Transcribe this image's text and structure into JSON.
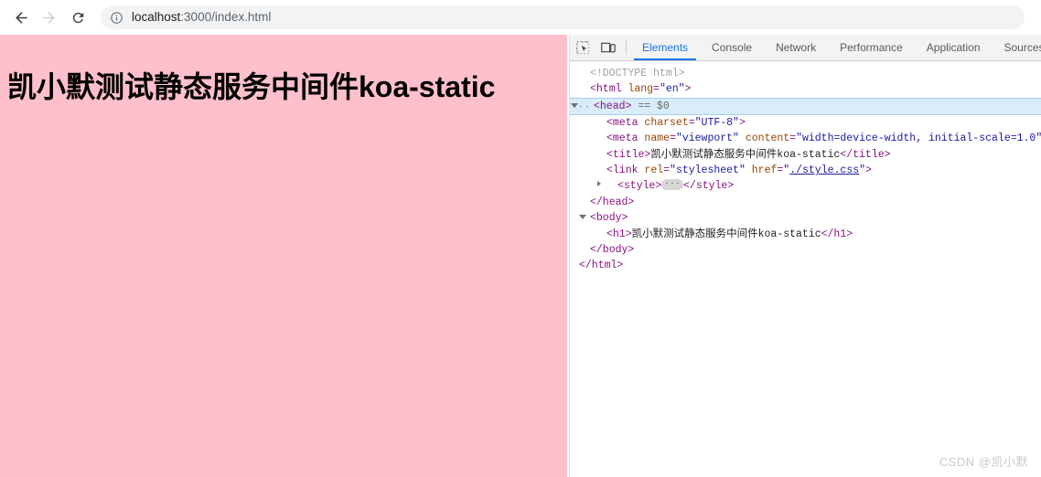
{
  "browser": {
    "back_label": "Back",
    "forward_label": "Forward",
    "reload_label": "Reload",
    "url_host": "localhost",
    "url_path": ":3000/index.html",
    "url_full": "localhost:3000/index.html",
    "info_icon": "info-circle-icon"
  },
  "page": {
    "heading": "凯小默测试静态服务中间件koa-static",
    "background_color": "#ffc0cb"
  },
  "devtools": {
    "inspect_icon": "inspect-element-icon",
    "device_icon": "device-toolbar-icon",
    "accent_color": "#1a73e8",
    "tabs": [
      {
        "label": "Elements",
        "active": true
      },
      {
        "label": "Console",
        "active": false
      },
      {
        "label": "Network",
        "active": false
      },
      {
        "label": "Performance",
        "active": false
      },
      {
        "label": "Application",
        "active": false
      },
      {
        "label": "Sources",
        "active": false
      }
    ],
    "dom": {
      "doctype": "<!DOCTYPE html>",
      "html_open_tag": "<html",
      "html_attr_name": "lang",
      "html_attr_value": "\"en\"",
      "html_close_bracket": ">",
      "head_open": "<head>",
      "head_marker": "== $0",
      "head_dots": "···",
      "meta_charset": {
        "open": "<meta",
        "attr_name": "charset",
        "attr_value": "\"UTF-8\"",
        "close": ">"
      },
      "meta_viewport": {
        "open": "<meta",
        "attr1_name": "name",
        "attr1_value": "\"viewport\"",
        "attr2_name": "content",
        "attr2_value": "\"width=device-width, initial-scale=1.0\"",
        "close": ">"
      },
      "title": {
        "open": "<title>",
        "text": "凯小默测试静态服务中间件koa-static",
        "close": "</title>"
      },
      "link": {
        "open": "<link",
        "attr1_name": "rel",
        "attr1_value": "\"stylesheet\"",
        "attr2_name": "href",
        "attr2_quote_open": "\"",
        "attr2_value": "./style.css",
        "attr2_quote_close": "\"",
        "close": ">"
      },
      "style": {
        "open": "<style>",
        "ellipsis": "···",
        "close": "</style>"
      },
      "head_close": "</head>",
      "body_open": "<body>",
      "h1": {
        "open": "<h1>",
        "text": "凯小默测试静态服务中间件koa-static",
        "close": "</h1>"
      },
      "body_close": "</body>",
      "html_close": "</html>"
    }
  },
  "watermark": {
    "text": "CSDN @凯小默"
  }
}
